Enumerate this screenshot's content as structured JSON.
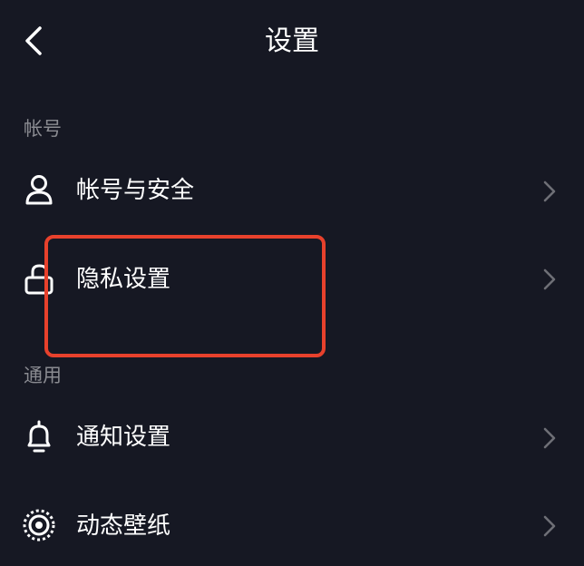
{
  "header": {
    "title": "设置",
    "back_icon": "chevron-left-icon"
  },
  "sections": [
    {
      "label": "帐号",
      "items": [
        {
          "label": "帐号与安全",
          "icon": "user-icon"
        },
        {
          "label": "隐私设置",
          "icon": "lock-icon"
        }
      ]
    },
    {
      "label": "通用",
      "items": [
        {
          "label": "通知设置",
          "icon": "bell-icon"
        },
        {
          "label": "动态壁纸",
          "icon": "live-wallpaper-icon"
        }
      ]
    }
  ],
  "annotation": {
    "color": "#e8412c"
  },
  "theme": {
    "background": "#161823",
    "text": "#ffffff",
    "muted": "#8a8b91",
    "chevron": "#6e6f76"
  }
}
